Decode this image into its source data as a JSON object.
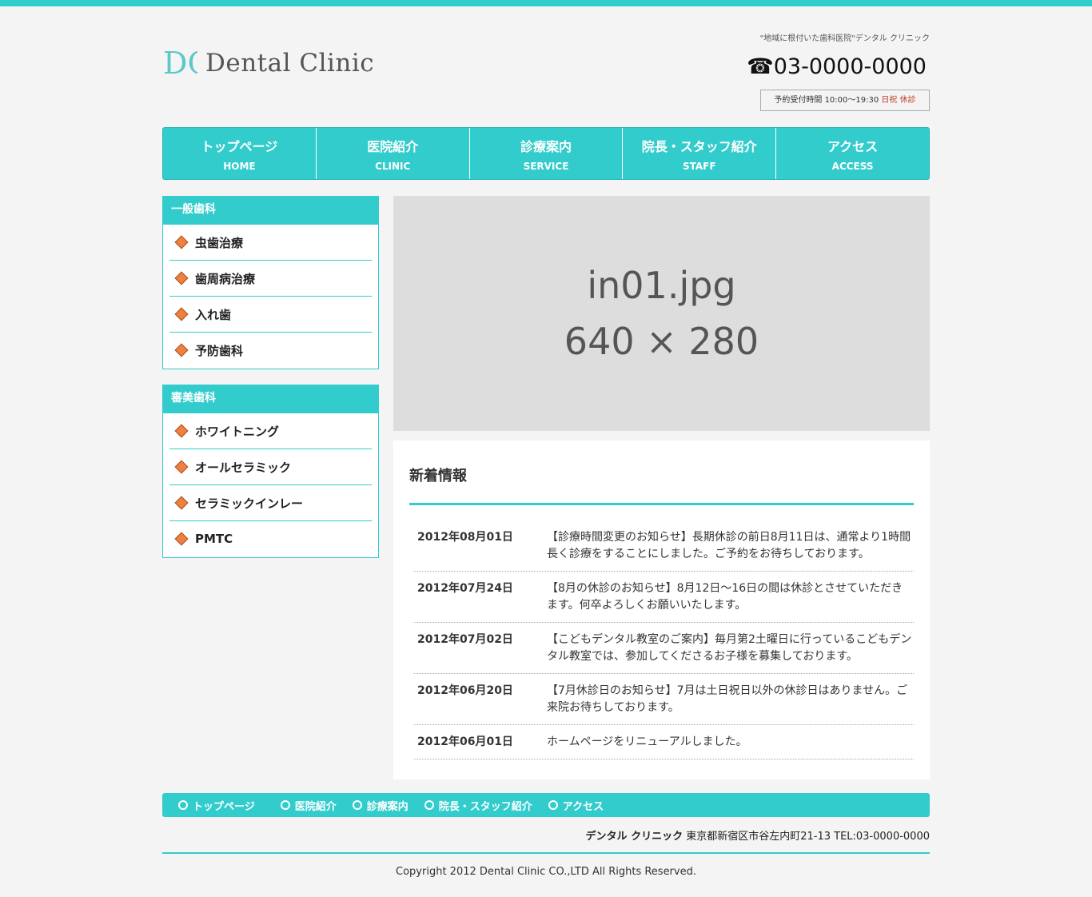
{
  "header": {
    "logo_text": "Dental Clinic",
    "logo_monogram": "DC",
    "tagline": "\"地域に根付いた歯科医院\"デンタル クリニック",
    "tel_icon": "☎",
    "tel": "03-0000-0000",
    "hours_label": "予約受付時間 10:00～19:30",
    "hours_closed": "日祝 休診"
  },
  "nav": {
    "items": [
      {
        "jp": "トップページ",
        "en": "HOME"
      },
      {
        "jp": "医院紹介",
        "en": "CLINIC"
      },
      {
        "jp": "診療案内",
        "en": "SERVICE"
      },
      {
        "jp": "院長・スタッフ紹介",
        "en": "STAFF"
      },
      {
        "jp": "アクセス",
        "en": "ACCESS"
      }
    ]
  },
  "sidebar": {
    "general": {
      "title": "一般歯科",
      "items": [
        "虫歯治療",
        "歯周病治療",
        "入れ歯",
        "予防歯科"
      ]
    },
    "cosmetic": {
      "title": "審美歯科",
      "items": [
        "ホワイトニング",
        "オールセラミック",
        "セラミックインレー",
        "PMTC"
      ]
    }
  },
  "hero": {
    "line1": "in01.jpg",
    "line2": "640 × 280"
  },
  "news": {
    "title": "新着情報",
    "items": [
      {
        "date": "2012年08月01日",
        "text": "【診療時間変更のお知らせ】長期休診の前日8月11日は、通常より1時間長く診療をすることにしました。ご予約をお待ちしております。"
      },
      {
        "date": "2012年07月24日",
        "text": "【8月の休診のお知らせ】8月12日～16日の間は休診とさせていただきます。何卒よろしくお願いいたします。"
      },
      {
        "date": "2012年07月02日",
        "text": "【こどもデンタル教室のご案内】毎月第2土曜日に行っているこどもデンタル教室では、参加してくださるお子様を募集しております。"
      },
      {
        "date": "2012年06月20日",
        "text": "【7月休診日のお知らせ】7月は土日祝日以外の休診日はありません。ご来院お待ちしております。"
      },
      {
        "date": "2012年06月01日",
        "text": "ホームページをリニューアルしました。"
      }
    ]
  },
  "footer": {
    "nav": [
      "トップページ",
      "医院紹介",
      "診療案内",
      "院長・スタッフ紹介",
      "アクセス"
    ],
    "clinic_name": "デンタル クリニック",
    "address": "東京都新宿区市谷左内町21-13 TEL:03-0000-0000",
    "copyright": "Copyright 2012 Dental Clinic CO.,LTD All Rights Reserved."
  },
  "colors": {
    "accent": "#33cccc",
    "bullet": "#f08040",
    "background": "#f4f4f4"
  }
}
